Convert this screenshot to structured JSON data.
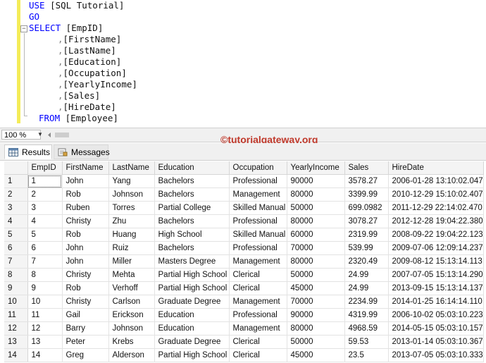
{
  "editor": {
    "lines": [
      {
        "kw": "USE",
        "rest": " [SQL Tutorial]"
      },
      {
        "kw": "GO",
        "rest": ""
      },
      {
        "kw": "SELECT",
        "rest": " [EmpID]"
      },
      {
        "comma": ",",
        "rest": "[FirstName]"
      },
      {
        "comma": ",",
        "rest": "[LastName]"
      },
      {
        "comma": ",",
        "rest": "[Education]"
      },
      {
        "comma": ",",
        "rest": "[Occupation]"
      },
      {
        "comma": ",",
        "rest": "[YearlyIncome]"
      },
      {
        "comma": ",",
        "rest": "[Sales]"
      },
      {
        "comma": ",",
        "rest": "[HireDate]"
      },
      {
        "kw": "FROM",
        "rest": " [Employee]"
      }
    ],
    "collapse_symbol": "−"
  },
  "zoom": {
    "value": "100 %",
    "arrow": "▼"
  },
  "watermark": "©tutorialgateway.org",
  "tabs": [
    {
      "label": "Results",
      "icon": "grid-icon",
      "active": true
    },
    {
      "label": "Messages",
      "icon": "messages-icon",
      "active": false
    }
  ],
  "results": {
    "columns": [
      "",
      "EmpID",
      "FirstName",
      "LastName",
      "Education",
      "Occupation",
      "YearlyIncome",
      "Sales",
      "HireDate"
    ],
    "rows": [
      [
        "1",
        "1",
        "John",
        "Yang",
        "Bachelors",
        "Professional",
        "90000",
        "3578.27",
        "2006-01-28 13:10:02.047"
      ],
      [
        "2",
        "2",
        "Rob",
        "Johnson",
        "Bachelors",
        "Management",
        "80000",
        "3399.99",
        "2010-12-29 15:10:02.407"
      ],
      [
        "3",
        "3",
        "Ruben",
        "Torres",
        "Partial College",
        "Skilled Manual",
        "50000",
        "699.0982",
        "2011-12-29 22:14:02.470"
      ],
      [
        "4",
        "4",
        "Christy",
        "Zhu",
        "Bachelors",
        "Professional",
        "80000",
        "3078.27",
        "2012-12-28 19:04:22.380"
      ],
      [
        "5",
        "5",
        "Rob",
        "Huang",
        "High School",
        "Skilled Manual",
        "60000",
        "2319.99",
        "2008-09-22 19:04:22.123"
      ],
      [
        "6",
        "6",
        "John",
        "Ruiz",
        "Bachelors",
        "Professional",
        "70000",
        "539.99",
        "2009-07-06 12:09:14.237"
      ],
      [
        "7",
        "7",
        "John",
        "Miller",
        "Masters Degree",
        "Management",
        "80000",
        "2320.49",
        "2009-08-12 15:13:14.113"
      ],
      [
        "8",
        "8",
        "Christy",
        "Mehta",
        "Partial High School",
        "Clerical",
        "50000",
        "24.99",
        "2007-07-05 15:13:14.290"
      ],
      [
        "9",
        "9",
        "Rob",
        "Verhoff",
        "Partial High School",
        "Clerical",
        "45000",
        "24.99",
        "2013-09-15 15:13:14.137"
      ],
      [
        "10",
        "10",
        "Christy",
        "Carlson",
        "Graduate Degree",
        "Management",
        "70000",
        "2234.99",
        "2014-01-25 16:14:14.110"
      ],
      [
        "11",
        "11",
        "Gail",
        "Erickson",
        "Education",
        "Professional",
        "90000",
        "4319.99",
        "2006-10-02 05:03:10.223"
      ],
      [
        "12",
        "12",
        "Barry",
        "Johnson",
        "Education",
        "Management",
        "80000",
        "4968.59",
        "2014-05-15 05:03:10.157"
      ],
      [
        "13",
        "13",
        "Peter",
        "Krebs",
        "Graduate Degree",
        "Clerical",
        "50000",
        "59.53",
        "2013-01-14 05:03:10.367"
      ],
      [
        "14",
        "14",
        "Greg",
        "Alderson",
        "Partial High School",
        "Clerical",
        "45000",
        "23.5",
        "2013-07-05 05:03:10.333"
      ]
    ]
  }
}
